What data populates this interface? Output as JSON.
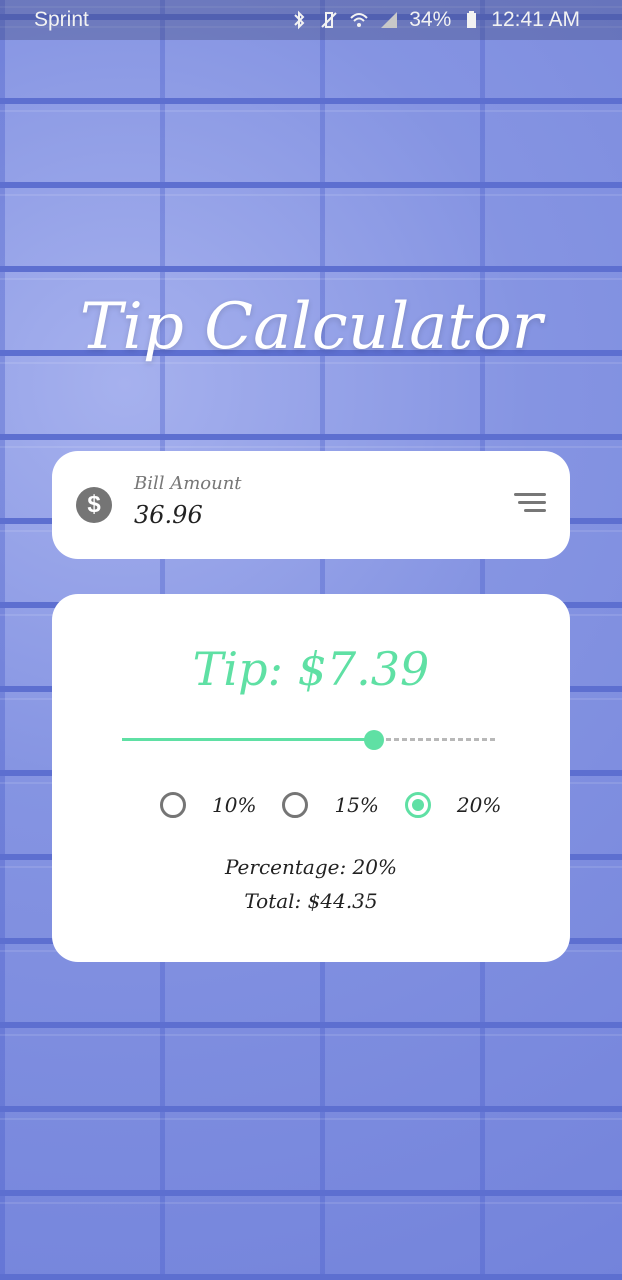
{
  "status_bar": {
    "carrier": "Sprint",
    "battery": "34%",
    "time": "12:41 AM",
    "icons": [
      "bluetooth-icon",
      "vibrate-icon",
      "wifi-icon",
      "signal-icon",
      "battery-icon"
    ]
  },
  "app": {
    "title": "Tip Calculator"
  },
  "bill": {
    "label": "Bill Amount",
    "value": "36.96"
  },
  "tip": {
    "amount_text": "Tip: $7.39",
    "slider_value_fraction": 0.67,
    "options": [
      {
        "label": "10%",
        "checked": false
      },
      {
        "label": "15%",
        "checked": false
      },
      {
        "label": "20%",
        "checked": true
      }
    ],
    "percentage_text": "Percentage: 20%",
    "total_text": "Total: $44.35"
  },
  "colors": {
    "accent": "#5fe0a4",
    "background": "#7f8fe0",
    "card": "#ffffff"
  }
}
